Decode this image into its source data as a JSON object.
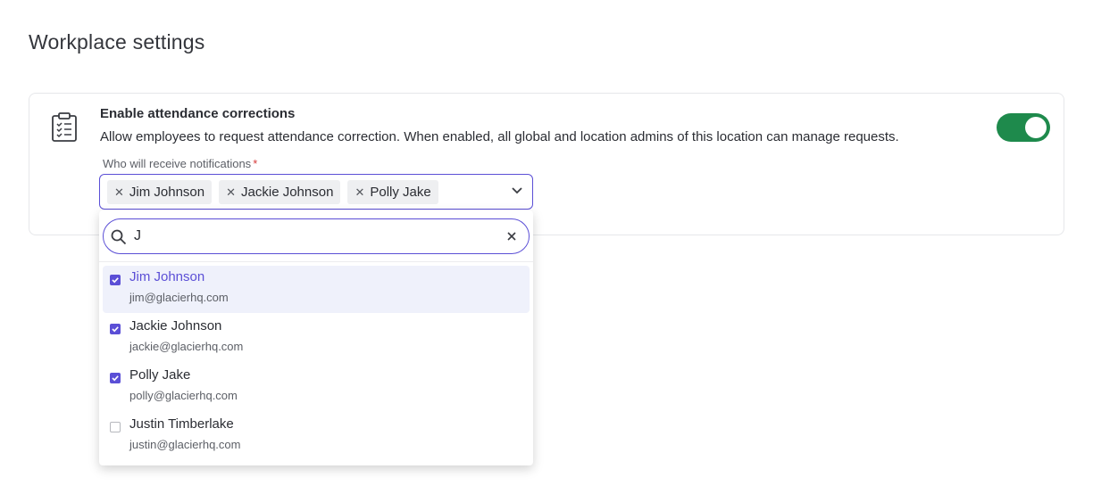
{
  "page": {
    "title": "Workplace settings"
  },
  "setting": {
    "title": "Enable attendance corrections",
    "description": "Allow employees to request attendance correction.  When enabled, all global and location admins of this location can manage requests.",
    "enabled": true,
    "toggle_color": "#1e8a4c",
    "icon": "clipboard-checklist-icon"
  },
  "notifications": {
    "label": "Who will receive notifications",
    "required_mark": "*",
    "selected": [
      {
        "name": "Jim Johnson"
      },
      {
        "name": "Jackie Johnson"
      },
      {
        "name": "Polly Jake"
      }
    ],
    "chip_remove_icon": "close-icon",
    "expand_icon": "chevron-down-icon"
  },
  "dropdown": {
    "search_value": "J",
    "search_icon": "search-icon",
    "clear_icon": "close-icon",
    "options": [
      {
        "name": "Jim Johnson",
        "email": "jim@glacierhq.com",
        "checked": true,
        "highlighted": true
      },
      {
        "name": "Jackie Johnson",
        "email": "jackie@glacierhq.com",
        "checked": true,
        "highlighted": false
      },
      {
        "name": "Polly Jake",
        "email": "polly@glacierhq.com",
        "checked": true,
        "highlighted": false
      },
      {
        "name": "Justin Timberlake",
        "email": "justin@glacierhq.com",
        "checked": false,
        "highlighted": false
      }
    ]
  },
  "colors": {
    "accent": "#5b4fd6",
    "toggle_on": "#1e8a4c",
    "required": "#d63a3a"
  }
}
